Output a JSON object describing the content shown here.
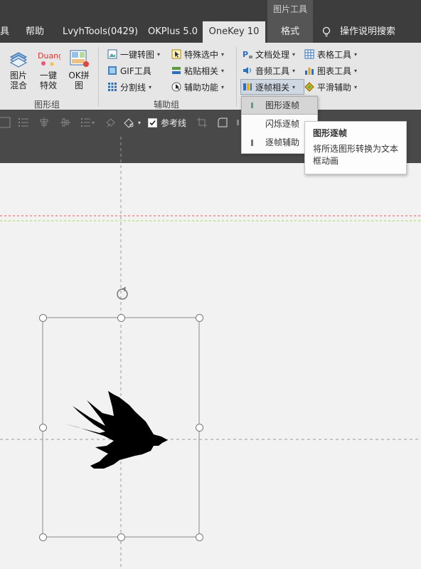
{
  "context_tab_title": "图片工具",
  "tabs": [
    {
      "label": "具"
    },
    {
      "label": "帮助"
    },
    {
      "label": "LvyhTools(0429)"
    },
    {
      "label": "OKPlus 5.0"
    },
    {
      "label": "OneKey 10"
    },
    {
      "label": "格式"
    },
    {
      "label": "操作说明搜索"
    }
  ],
  "ribbon": {
    "image_group": {
      "label": "图形组",
      "buttons": [
        {
          "label": "图片混合",
          "icon": "image-blend-icon"
        },
        {
          "label": "一键特效",
          "icon": "duang-icon",
          "icon_text": "Duang"
        },
        {
          "label": "OK拼图",
          "icon": "ok-puzzle-icon"
        }
      ]
    },
    "helper_group": {
      "label": "辅助组",
      "items": [
        {
          "label": "一键转图",
          "icon": "convert-image-icon"
        },
        {
          "label": "特殊选中",
          "icon": "special-select-icon"
        },
        {
          "label": "GIF工具",
          "icon": "gif-icon"
        },
        {
          "label": "粘贴相关",
          "icon": "paste-icon"
        },
        {
          "label": "分割线",
          "icon": "divider-icon"
        },
        {
          "label": "辅助功能",
          "icon": "assist-icon"
        }
      ]
    },
    "right_group": {
      "items": [
        {
          "label": "文档处理",
          "icon": "document-icon"
        },
        {
          "label": "表格工具",
          "icon": "table-icon"
        },
        {
          "label": "音频工具",
          "icon": "audio-icon"
        },
        {
          "label": "图表工具",
          "icon": "chart-icon"
        },
        {
          "label": "逐帧相关",
          "icon": "frame-icon"
        },
        {
          "label": "平滑辅助",
          "icon": "smooth-icon"
        }
      ]
    }
  },
  "toolbar": {
    "guide_checkbox_label": "参考线",
    "guide_checked": true
  },
  "dropdown": {
    "items": [
      {
        "label": "图形逐帧"
      },
      {
        "label": "闪烁逐帧"
      },
      {
        "label": "逐帧辅助"
      }
    ]
  },
  "tooltip": {
    "title": "图形逐帧",
    "description": "将所选图形转换为文本框动画"
  },
  "colors": {
    "dark_bar": "#3d3d3d",
    "ribbon_bg": "#e6e6e6",
    "canvas_bg": "#f2f2f2",
    "guide_red": "#e06060",
    "guide_green": "#a8d060"
  }
}
